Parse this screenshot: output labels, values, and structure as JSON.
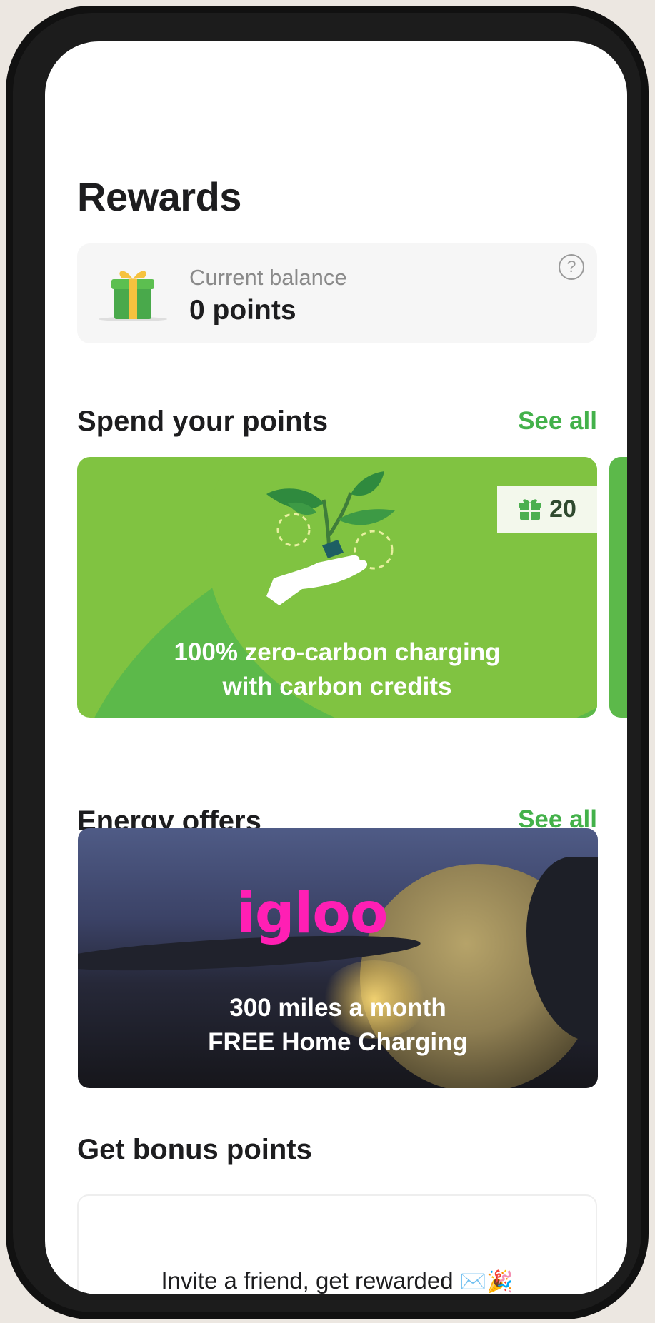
{
  "header": {
    "title": "Rewards"
  },
  "balance": {
    "label": "Current balance",
    "value": "0 points",
    "help_icon": "?"
  },
  "spend_section": {
    "title": "Spend your points",
    "see_all": "See all",
    "card": {
      "badge_value": "20",
      "caption_line1": "100% zero-carbon charging",
      "caption_line2": "with carbon credits",
      "color": "#5cb94a"
    }
  },
  "energy_section": {
    "title": "Energy offers",
    "see_all": "See all",
    "card": {
      "logo": "igloo",
      "caption_line1": "300 miles a month",
      "caption_line2": "FREE Home Charging",
      "logo_color": "#ff1fb4"
    }
  },
  "bonus_section": {
    "title": "Get bonus points",
    "card_text": "Invite a friend, get rewarded",
    "card_emoji": "✉️🎉"
  },
  "colors": {
    "accent": "#43b14a",
    "text": "#1d1d1f"
  }
}
